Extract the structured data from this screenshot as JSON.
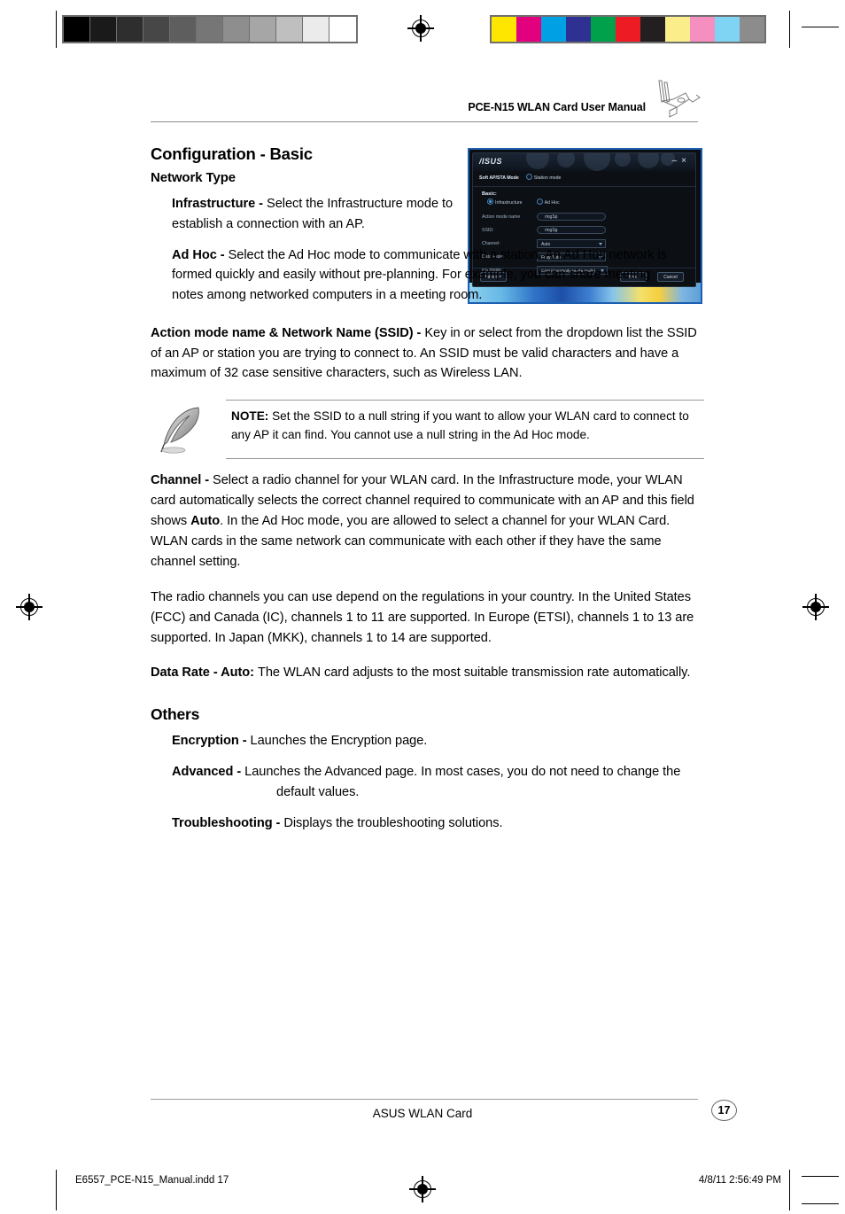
{
  "document": {
    "header_title": "PCE-N15 WLAN Card User Manual",
    "footer_text": "ASUS WLAN Card",
    "page_number": "17",
    "print_file": "E6557_PCE-N15_Manual.indd   17",
    "print_timestamp": "4/8/11   2:56:49 PM"
  },
  "calibration": {
    "grayscale": [
      "#000000",
      "#1a1a1a",
      "#2e2e2e",
      "#474747",
      "#5e5e5e",
      "#767676",
      "#8e8e8e",
      "#a6a6a6",
      "#bfbfbf",
      "#ebebeb",
      "#ffffff"
    ],
    "colors": [
      "#ffe600",
      "#e2007f",
      "#00a0e4",
      "#2e3192",
      "#00a14b",
      "#ed1c24",
      "#231f20",
      "#fbee8a",
      "#f48fc0",
      "#7fd4f4",
      "#8c8c8c"
    ]
  },
  "content": {
    "section_title": "Configuration - Basic",
    "subsection_title": "Network Type",
    "infrastructure_label": "Infrastructure - ",
    "infrastructure_text": "Select the Infrastructure mode to establish a connection with an AP.",
    "adhoc_label": "Ad Hoc - ",
    "adhoc_text": "Select the Ad Hoc mode to communicate with a station. An Ad Hoc network is formed quickly and easily without pre-planning. For example, you can share meeting notes among networked computers in a meeting room.",
    "ssid_label": "Action mode name & Network Name (SSID) - ",
    "ssid_text": "Key in or select from the dropdown list the SSID of an AP or station you are trying to connect to. An SSID must be valid characters and have a maximum of 32 case sensitive characters, such as Wireless LAN.",
    "note_label": "NOTE:",
    "note_text": " Set the SSID to a null string if you want to allow your WLAN card to connect to any AP it can find. You cannot use a null string in the Ad Hoc mode.",
    "channel_label": "Channel - ",
    "channel_text_a": "Select a radio channel for your WLAN card. In the Infrastructure mode, your WLAN card automatically selects the correct channel required to communicate with an AP and this field shows ",
    "channel_bold_auto": "Auto",
    "channel_text_b": ". In the Ad Hoc mode, you are allowed to select a channel for your WLAN Card. WLAN cards in the same network can communicate with each other if they have the same channel setting.",
    "regulations_text": "The radio channels you can use depend on the regulations in your country. In the United States (FCC) and Canada (IC), channels 1 to 11 are supported. In Europe (ETSI), channels 1 to 13 are supported. In Japan (MKK), channels 1 to 14 are supported.",
    "datarate_label": "Data Rate - Auto: ",
    "datarate_text": "The WLAN card adjusts to the most suitable transmission rate automatically.",
    "others_title": "Others",
    "encryption_label": "Encryption - ",
    "encryption_text": "Launches the Encryption page.",
    "advanced_label": "Advanced - ",
    "advanced_text": "Launches the Advanced page. In most cases, you do not need to change the default values.",
    "troubleshooting_label": "Troubleshooting - ",
    "troubleshooting_text": "Displays the troubleshooting solutions."
  },
  "app_screenshot": {
    "brand": "/ISUS",
    "minimize": "–",
    "close": "×",
    "tab_softap": "Soft AP/STA Mode",
    "tab_station": "Station mode",
    "group_label": "Basic:",
    "radio_infrastructure": "Infrastructure",
    "radio_adhoc": "Ad Hoc",
    "fields": [
      {
        "label": "Action mode name",
        "value": "ringSp",
        "type": "input"
      },
      {
        "label": "SSID:",
        "value": "ringSg",
        "type": "input"
      },
      {
        "label": "Channel:",
        "value": "Auto",
        "type": "select"
      },
      {
        "label": "Data Rate:",
        "value": "Fully Auto",
        "type": "select"
      },
      {
        "label": "PS mode:",
        "value": "CAM (Constantly Awake mode)",
        "type": "select"
      }
    ],
    "btn_advance": "Advance",
    "btn_next": "Next",
    "btn_cancel": "Cancel"
  }
}
